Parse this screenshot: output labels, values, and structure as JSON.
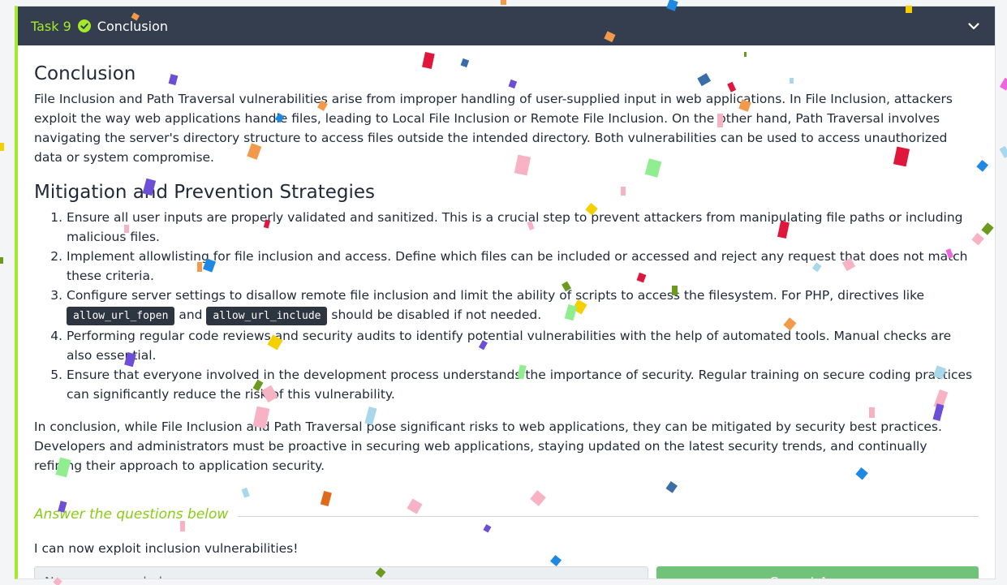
{
  "task": {
    "number_label": "Task 9",
    "title": "Conclusion",
    "status": "completed",
    "accent": "#a3ea2a",
    "header_bg": "#343e4e"
  },
  "conclusion": {
    "heading": "Conclusion",
    "text": "File Inclusion and Path Traversal vulnerabilities arise from improper handling of user-supplied input in web applications. In File Inclusion, attackers exploit the way web applications handle files, leading to Local File Inclusion or Remote File Inclusion. On the other hand, Path Traversal involves navigating the server's directory structure to access files outside the intended directory. Both vulnerabilities can be used to access unauthorized data or system compromise."
  },
  "mitigation": {
    "heading": "Mitigation and Prevention Strategies",
    "items": [
      "Ensure all user inputs are properly validated and sanitized. This is a crucial step to prevent attackers from manipulating file paths or including malicious files.",
      "Implement allowlisting for file inclusion and access. Define which files can be included or accessed and reject any request that does not match these criteria.",
      {
        "before": "Configure server settings to disallow remote file inclusion and limit the ability of scripts to access the filesystem. For PHP, directives like ",
        "code1": "allow_url_fopen",
        "mid": " and ",
        "code2": "allow_url_include",
        "after": " should be disabled if not needed."
      },
      "Performing regular code reviews and security audits to identify potential vulnerabilities with the help of automated tools. Manual checks are also essential.",
      "Ensure that everyone involved in the development process understands the importance of security. Regular training on secure coding practices can significantly reduce the risk of this vulnerability."
    ]
  },
  "summary": "In conclusion, while File Inclusion and Path Traversal pose significant risks to web applications, they can be mitigated by security best practices. Developers and administrators must be proactive in securing web applications, staying updated on the latest security trends, and continually refining their approach to application security.",
  "questions": {
    "title": "Answer the questions below",
    "question": "I can now exploit inclusion vulnerabilities!",
    "answer_placeholder": "No answer needed",
    "button_label": "Correct Answer",
    "button_color": "#72c37a"
  },
  "icons": {
    "status": "check-circle-icon",
    "toggle": "chevron-down-icon"
  }
}
